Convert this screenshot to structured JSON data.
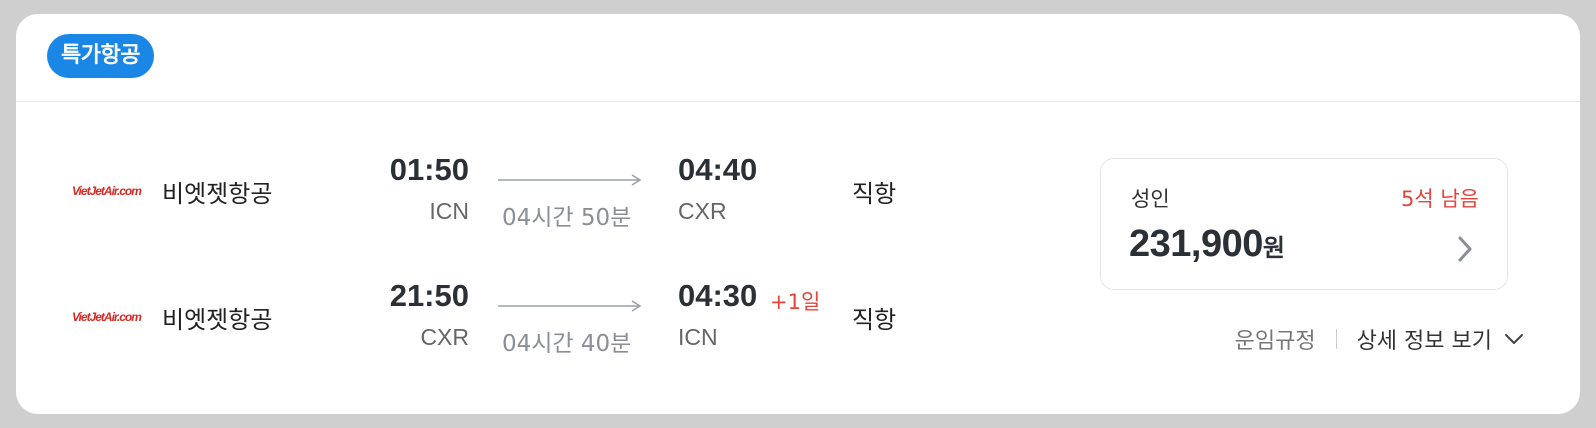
{
  "badge": "특가항공",
  "segments": [
    {
      "logo": "VietJetAir.com",
      "airline": "비엣젯항공",
      "dep_time": "01:50",
      "dep_code": "ICN",
      "duration": "04시간 50분",
      "arr_time": "04:40",
      "arr_code": "CXR",
      "plus_day": "",
      "stops": "직항"
    },
    {
      "logo": "VietJetAir.com",
      "airline": "비엣젯항공",
      "dep_time": "21:50",
      "dep_code": "CXR",
      "duration": "04시간 40분",
      "arr_time": "04:30",
      "arr_code": "ICN",
      "plus_day": "+1일",
      "stops": "직항"
    }
  ],
  "price": {
    "pax_label": "성인",
    "seats_left": "5석 남음",
    "amount": "231,900",
    "currency": "원"
  },
  "links": {
    "fare_rule": "운임규정",
    "details": "상세 정보 보기"
  },
  "colors": {
    "badge": "#1a86e6",
    "alert": "#e5433c",
    "logo": "#d62a24"
  }
}
